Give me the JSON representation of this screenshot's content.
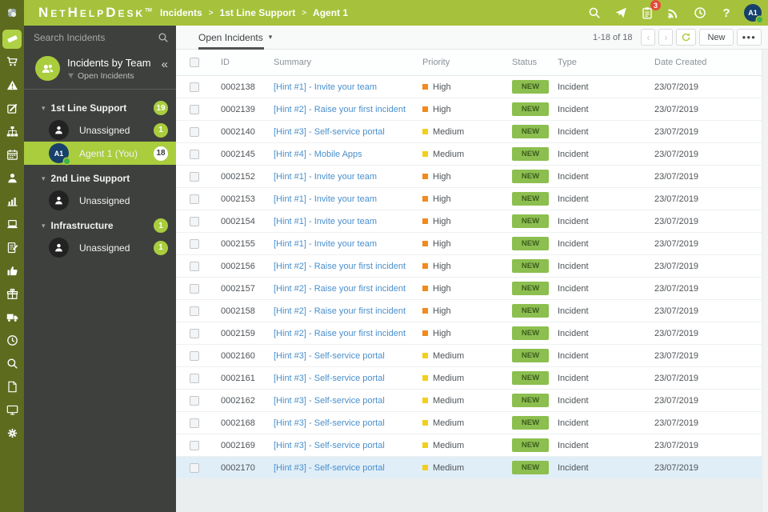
{
  "topbar": {
    "brand": "NetHelpDesk",
    "trademark": "TM",
    "breadcrumb": [
      "Incidents",
      "1st Line Support",
      "Agent 1"
    ],
    "separator": ">",
    "notification_count": "3",
    "avatar_initials": "A1",
    "help_glyph": "?"
  },
  "rail": {
    "items": [
      {
        "icon": "ticket",
        "active": true
      },
      {
        "icon": "cart",
        "active": false
      },
      {
        "icon": "warning",
        "active": false
      },
      {
        "icon": "compose",
        "active": false
      },
      {
        "icon": "sitemap",
        "active": false
      },
      {
        "icon": "calendar",
        "active": false
      },
      {
        "icon": "user",
        "active": false
      },
      {
        "icon": "chart",
        "active": false
      },
      {
        "icon": "laptop",
        "active": false
      },
      {
        "icon": "note",
        "active": false
      },
      {
        "icon": "thumb",
        "active": false
      },
      {
        "icon": "gift",
        "active": false
      },
      {
        "icon": "truck",
        "active": false
      },
      {
        "icon": "clock",
        "active": false
      },
      {
        "icon": "search",
        "active": false
      },
      {
        "icon": "file",
        "active": false
      },
      {
        "icon": "monitor",
        "active": false
      },
      {
        "icon": "gear",
        "active": false
      }
    ]
  },
  "sidebar": {
    "search_placeholder": "Search Incidents",
    "panel_title": "Incidents by Team",
    "panel_filter": "Open Incidents",
    "collapse_glyph": "«",
    "caret_glyph": "▾",
    "groups": [
      {
        "label": "1st Line Support",
        "count": "19",
        "children": [
          {
            "label": "Unassigned",
            "count": "1",
            "initials": null,
            "selected": false
          },
          {
            "label": "Agent 1 (You)",
            "count": "18",
            "initials": "A1",
            "selected": true
          }
        ]
      },
      {
        "label": "2nd Line Support",
        "count": null,
        "children": [
          {
            "label": "Unassigned",
            "count": null,
            "initials": null,
            "selected": false
          }
        ]
      },
      {
        "label": "Infrastructure",
        "count": "1",
        "children": [
          {
            "label": "Unassigned",
            "count": "1",
            "initials": null,
            "selected": false
          }
        ]
      }
    ]
  },
  "toolbar": {
    "view_label": "Open Incidents",
    "dropdown_glyph": "▾",
    "range_label": "1-18 of 18",
    "prev_glyph": "‹",
    "next_glyph": "›",
    "new_label": "New",
    "more_label": "●●●"
  },
  "table": {
    "columns": [
      "ID",
      "Summary",
      "Priority",
      "Status",
      "Type",
      "Date Created"
    ],
    "rows": [
      {
        "id": "0002138",
        "summary": "[Hint #1] - Invite your team",
        "priority": "High",
        "status": "NEW",
        "type": "Incident",
        "date": "23/07/2019",
        "highlighted": false
      },
      {
        "id": "0002139",
        "summary": "[Hint #2] - Raise your first incident",
        "priority": "High",
        "status": "NEW",
        "type": "Incident",
        "date": "23/07/2019",
        "highlighted": false
      },
      {
        "id": "0002140",
        "summary": "[Hint #3] - Self-service portal",
        "priority": "Medium",
        "status": "NEW",
        "type": "Incident",
        "date": "23/07/2019",
        "highlighted": false
      },
      {
        "id": "0002145",
        "summary": "[Hint #4] - Mobile Apps",
        "priority": "Medium",
        "status": "NEW",
        "type": "Incident",
        "date": "23/07/2019",
        "highlighted": false
      },
      {
        "id": "0002152",
        "summary": "[Hint #1] - Invite your team",
        "priority": "High",
        "status": "NEW",
        "type": "Incident",
        "date": "23/07/2019",
        "highlighted": false
      },
      {
        "id": "0002153",
        "summary": "[Hint #1] - Invite your team",
        "priority": "High",
        "status": "NEW",
        "type": "Incident",
        "date": "23/07/2019",
        "highlighted": false
      },
      {
        "id": "0002154",
        "summary": "[Hint #1] - Invite your team",
        "priority": "High",
        "status": "NEW",
        "type": "Incident",
        "date": "23/07/2019",
        "highlighted": false
      },
      {
        "id": "0002155",
        "summary": "[Hint #1] - Invite your team",
        "priority": "High",
        "status": "NEW",
        "type": "Incident",
        "date": "23/07/2019",
        "highlighted": false
      },
      {
        "id": "0002156",
        "summary": "[Hint #2] - Raise your first incident",
        "priority": "High",
        "status": "NEW",
        "type": "Incident",
        "date": "23/07/2019",
        "highlighted": false
      },
      {
        "id": "0002157",
        "summary": "[Hint #2] - Raise your first incident",
        "priority": "High",
        "status": "NEW",
        "type": "Incident",
        "date": "23/07/2019",
        "highlighted": false
      },
      {
        "id": "0002158",
        "summary": "[Hint #2] - Raise your first incident",
        "priority": "High",
        "status": "NEW",
        "type": "Incident",
        "date": "23/07/2019",
        "highlighted": false
      },
      {
        "id": "0002159",
        "summary": "[Hint #2] - Raise your first incident",
        "priority": "High",
        "status": "NEW",
        "type": "Incident",
        "date": "23/07/2019",
        "highlighted": false
      },
      {
        "id": "0002160",
        "summary": "[Hint #3] - Self-service portal",
        "priority": "Medium",
        "status": "NEW",
        "type": "Incident",
        "date": "23/07/2019",
        "highlighted": false
      },
      {
        "id": "0002161",
        "summary": "[Hint #3] - Self-service portal",
        "priority": "Medium",
        "status": "NEW",
        "type": "Incident",
        "date": "23/07/2019",
        "highlighted": false
      },
      {
        "id": "0002162",
        "summary": "[Hint #3] - Self-service portal",
        "priority": "Medium",
        "status": "NEW",
        "type": "Incident",
        "date": "23/07/2019",
        "highlighted": false
      },
      {
        "id": "0002168",
        "summary": "[Hint #3] - Self-service portal",
        "priority": "Medium",
        "status": "NEW",
        "type": "Incident",
        "date": "23/07/2019",
        "highlighted": false
      },
      {
        "id": "0002169",
        "summary": "[Hint #3] - Self-service portal",
        "priority": "Medium",
        "status": "NEW",
        "type": "Incident",
        "date": "23/07/2019",
        "highlighted": false
      },
      {
        "id": "0002170",
        "summary": "[Hint #3] - Self-service portal",
        "priority": "Medium",
        "status": "NEW",
        "type": "Incident",
        "date": "23/07/2019",
        "highlighted": true
      }
    ]
  },
  "colors": {
    "accent": "#a9cd3d",
    "topbar_bg": "#a6c23c",
    "rail_bg": "#5d6b1e",
    "sidebar_bg": "#3e403e",
    "priority": {
      "High": "#f28a1f",
      "Medium": "#f2cf1d"
    },
    "status_new_bg": "#8cbf4f",
    "status_new_text": "#3e5c20",
    "link": "#4a8fcb",
    "highlight_row_bg": "#e0eef8",
    "badge_red": "#e64a3c"
  }
}
